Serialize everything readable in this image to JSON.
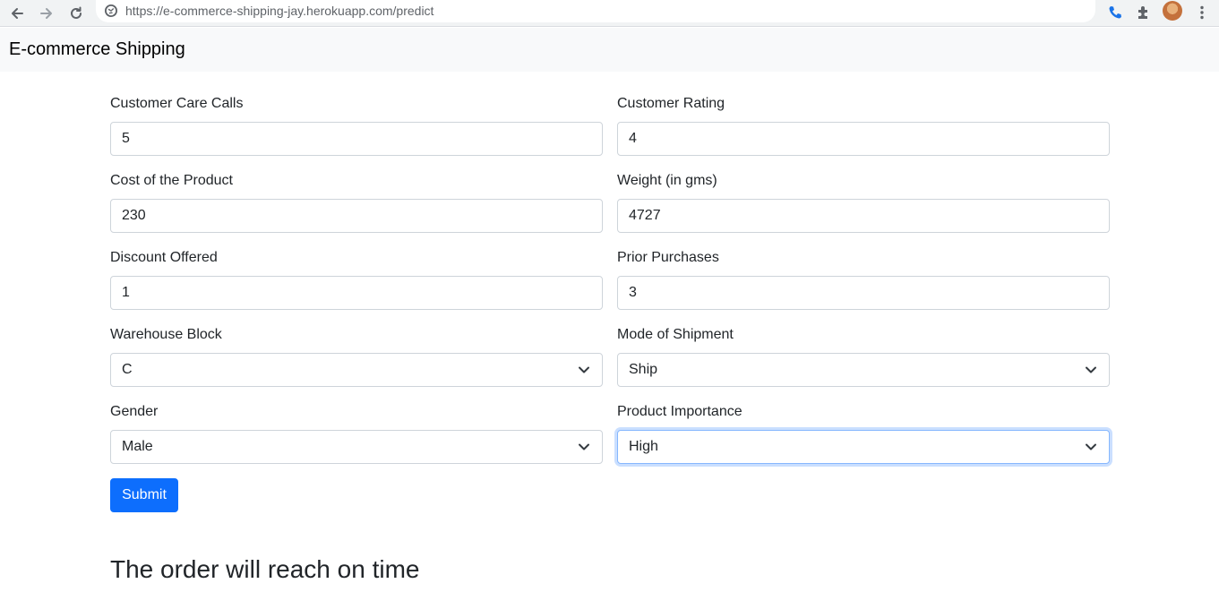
{
  "browser": {
    "url": "https://e-commerce-shipping-jay.herokuapp.com/predict",
    "icons": [
      "back-icon",
      "forward-icon",
      "reload-icon",
      "site-info-icon",
      "phone-icon",
      "extensions-icon",
      "avatar",
      "menu-icon"
    ]
  },
  "navbar": {
    "brand": "E-commerce Shipping"
  },
  "form": {
    "customer_care_calls": {
      "label": "Customer Care Calls",
      "value": "5"
    },
    "customer_rating": {
      "label": "Customer Rating",
      "value": "4"
    },
    "cost_of_product": {
      "label": "Cost of the Product",
      "value": "230"
    },
    "weight": {
      "label": "Weight (in gms)",
      "value": "4727"
    },
    "discount_offered": {
      "label": "Discount Offered",
      "value": "1"
    },
    "prior_purchases": {
      "label": "Prior Purchases",
      "value": "3"
    },
    "warehouse_block": {
      "label": "Warehouse Block",
      "value": "C"
    },
    "mode_of_shipment": {
      "label": "Mode of Shipment",
      "value": "Ship"
    },
    "gender": {
      "label": "Gender",
      "value": "Male"
    },
    "product_importance": {
      "label": "Product Importance",
      "value": "High"
    },
    "submit_label": "Submit"
  },
  "result": "The order will reach on time",
  "colors": {
    "primary": "#0d6efd",
    "navbar_bg": "#f8f9fa",
    "input_border": "#ced4da",
    "focus_border": "#86b7fe"
  }
}
